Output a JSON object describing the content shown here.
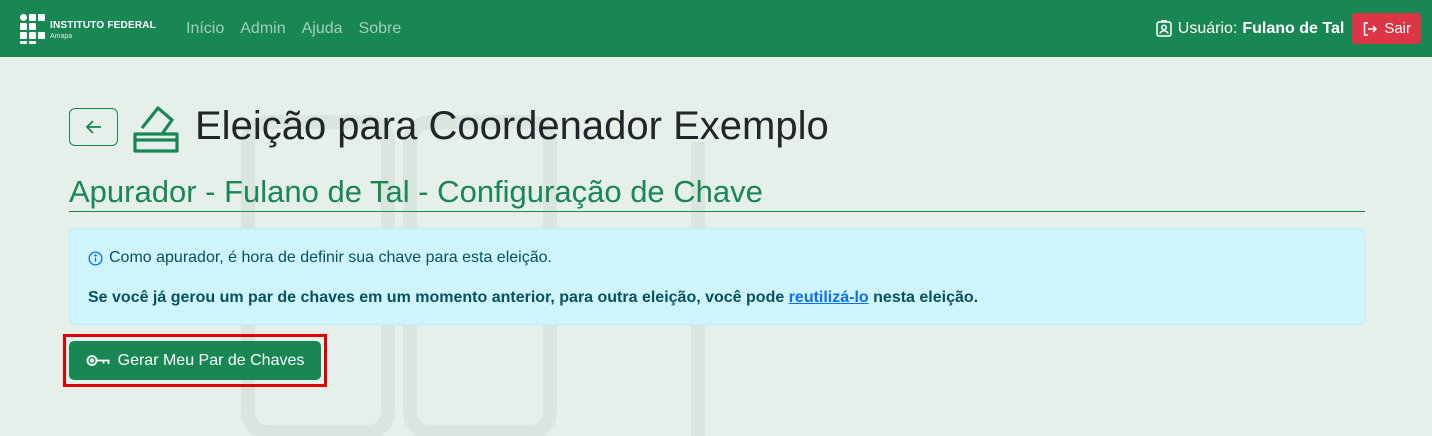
{
  "navbar": {
    "brand_line1": "INSTITUTO FEDERAL",
    "brand_line2": "Amapá",
    "links": [
      "Início",
      "Admin",
      "Ajuda",
      "Sobre"
    ],
    "user_label": "Usuário:",
    "user_name": "Fulano de Tal",
    "logout_label": "Sair"
  },
  "page": {
    "title": "Eleição para Coordenador Exemplo",
    "subtitle": "Apurador - Fulano de Tal - Configuração de Chave"
  },
  "alert": {
    "info_text": "Como apurador, é hora de definir sua chave para esta eleição.",
    "bold_prefix": "Se você já gerou um par de chaves em um momento anterior, para outra eleição, você pode ",
    "link_text": "reutilizá-lo",
    "bold_suffix": " nesta eleição."
  },
  "actions": {
    "generate_label": "Gerar Meu Par de Chaves"
  },
  "colors": {
    "brand_green": "#198754",
    "danger": "#dc3545",
    "info_bg": "#cff4fc",
    "info_text": "#055160",
    "link": "#0d6efd",
    "highlight": "#e10000"
  },
  "icons": [
    "logo-icon",
    "user-badge-icon",
    "logout-icon",
    "arrow-left-icon",
    "ballot-box-icon",
    "info-circle-icon",
    "key-icon"
  ]
}
